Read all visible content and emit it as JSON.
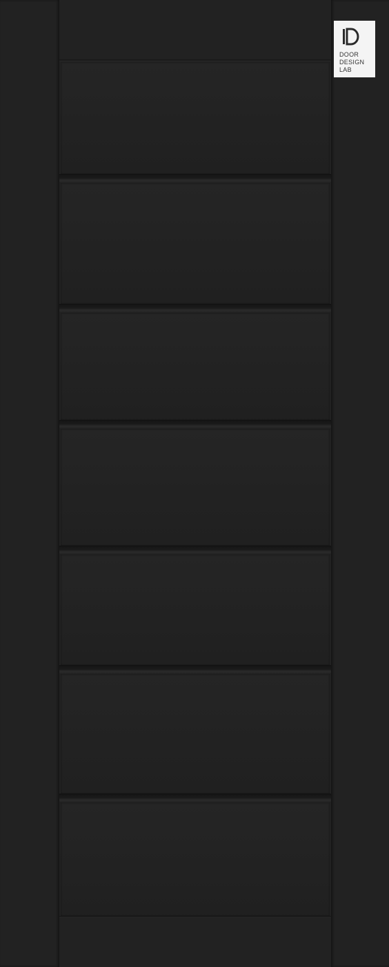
{
  "product": {
    "colors": {
      "door": "#232323",
      "groove_dark": "#111111",
      "groove_light": "#2a2a2a"
    },
    "panel_count": 8
  },
  "logo": {
    "icon": "dd-monogram-icon",
    "line1": "DOOR",
    "line2": "DESIGN",
    "line3": "LAB"
  }
}
